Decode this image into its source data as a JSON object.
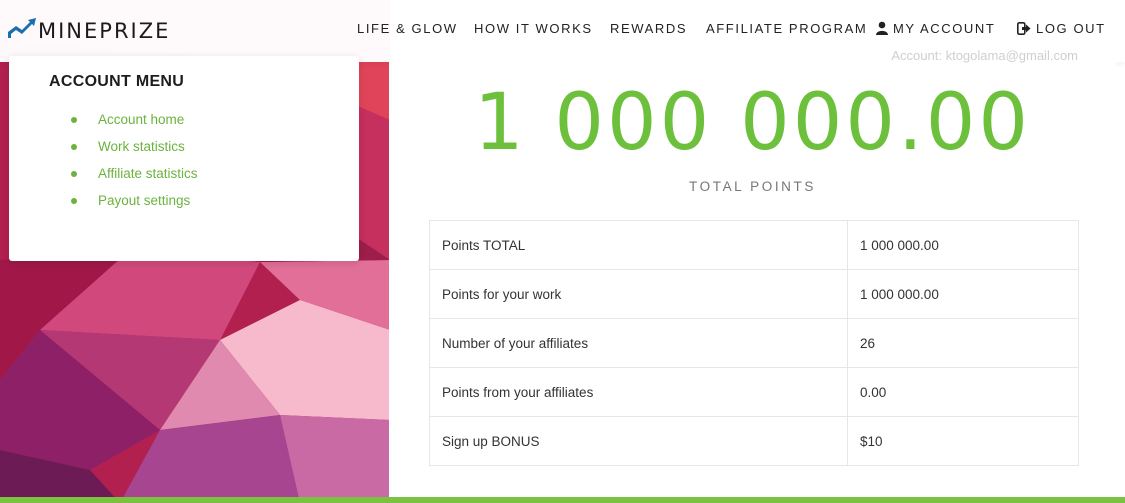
{
  "brand": {
    "name": "MINEPRIZE",
    "icon": "chart-trend-icon",
    "color": "#1a1a1a"
  },
  "nav": [
    {
      "label": "LIFE & GLOW",
      "icon": ""
    },
    {
      "label": "HOW IT WORKS",
      "icon": ""
    },
    {
      "label": "REWARDS",
      "icon": ""
    },
    {
      "label": "AFFILIATE PROGRAM",
      "icon": ""
    },
    {
      "label": "MY ACCOUNT",
      "icon": "user-icon"
    },
    {
      "label": "LOG OUT",
      "icon": "logout-icon"
    }
  ],
  "menu": {
    "title": "ACCOUNT MENU",
    "items": [
      {
        "label": "Account home"
      },
      {
        "label": "Work statistics"
      },
      {
        "label": "Affiliate statistics"
      },
      {
        "label": "Payout settings"
      }
    ]
  },
  "summary": {
    "email": "Account: ktogolama@gmail.com",
    "total_points": "1 000 000.00",
    "total_label": "TOTAL POINTS"
  },
  "stats": [
    {
      "label": "Points TOTAL",
      "value": "1 000 000.00"
    },
    {
      "label": "Points for your work",
      "value": "1 000 000.00"
    },
    {
      "label": "Number of your affiliates",
      "value": "26"
    },
    {
      "label": "Points from your affiliates",
      "value": "0.00"
    },
    {
      "label": "Sign up BONUS",
      "value": "$10"
    }
  ],
  "colors": {
    "accent": "#6cc03c",
    "link": "#6cb33e",
    "bottom_bar": "#7cc242"
  }
}
